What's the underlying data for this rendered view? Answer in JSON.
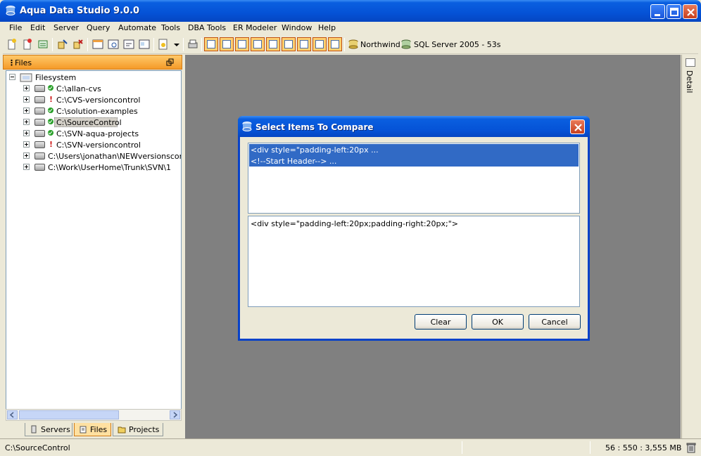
{
  "window": {
    "title": "Aqua Data Studio 9.0.0"
  },
  "menu": [
    "File",
    "Edit",
    "Server",
    "Query",
    "Automate",
    "Tools",
    "DBA Tools",
    "ER Modeler",
    "Window",
    "Help"
  ],
  "toolbar": {
    "connections": [
      {
        "label": "Northwind",
        "icon": "database-icon"
      },
      {
        "label": "SQL Server 2005 - 53s",
        "icon": "server-icon"
      }
    ]
  },
  "left_panel": {
    "title": "Files",
    "tree": {
      "root": "Filesystem",
      "items": [
        {
          "label": "C:\\allan-cvs",
          "status": "ok"
        },
        {
          "label": "C:\\CVS-versioncontrol",
          "status": "warn"
        },
        {
          "label": "C:\\solution-examples",
          "status": "ok"
        },
        {
          "label": "C:\\SourceControl",
          "status": "ok",
          "selected": true
        },
        {
          "label": "C:\\SVN-aqua-projects",
          "status": "ok"
        },
        {
          "label": "C:\\SVN-versioncontrol",
          "status": "warn"
        },
        {
          "label": "C:\\Users\\jonathan\\NEWversionscontro",
          "status": "none"
        },
        {
          "label": "C:\\Work\\UserHome\\Trunk\\SVN\\1",
          "status": "none"
        }
      ]
    },
    "tabs": [
      {
        "label": "Servers",
        "active": false
      },
      {
        "label": "Files",
        "active": true
      },
      {
        "label": "Projects",
        "active": false
      }
    ]
  },
  "right_strip": {
    "label": "Detail"
  },
  "dialog": {
    "title": "Select Items To Compare",
    "list_items": [
      "<div  style=\"padding-left:20px ...",
      "<!--Start Header--> ..."
    ],
    "preview_text": "<div  style=\"padding-left:20px;padding-right:20px;\">",
    "buttons": {
      "clear": "Clear",
      "ok": "OK",
      "cancel": "Cancel"
    }
  },
  "status_bar": {
    "path": "C:\\SourceControl",
    "memory": "56 : 550 : 3,555 MB"
  },
  "colors": {
    "titlebar": "#0552d6",
    "selection": "#316ac5",
    "panel_header": "#f59a28",
    "workspace": "#808080"
  }
}
